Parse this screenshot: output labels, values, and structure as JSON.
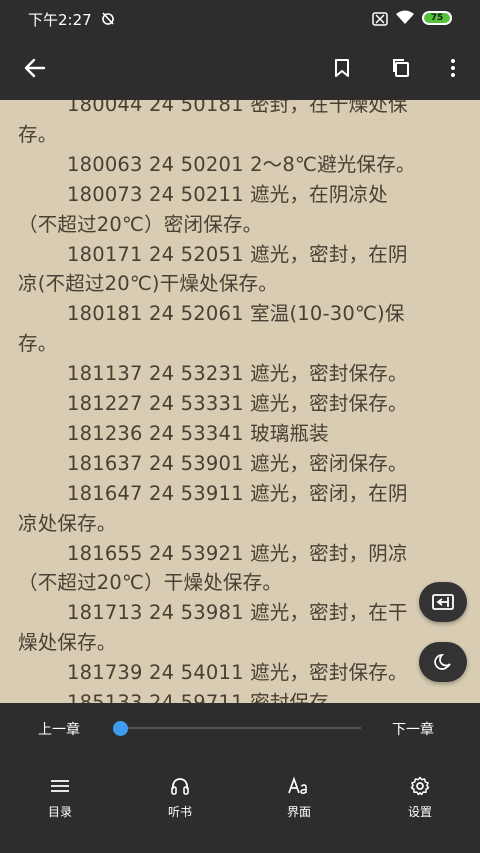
{
  "status_bar": {
    "time": "下午2:27",
    "battery": "75"
  },
  "content": {
    "lines": [
      {
        "text": "180044 24 50181 密封，在干燥处保",
        "indent": true
      },
      {
        "text": "存。",
        "indent": false
      },
      {
        "text": "180063 24 50201 2～8℃避光保存。",
        "indent": true
      },
      {
        "text": "180073 24 50211 遮光，在阴凉处",
        "indent": true
      },
      {
        "text": "（不超过20℃）密闭保存。",
        "indent": false
      },
      {
        "text": "180171 24 52051 遮光，密封，在阴",
        "indent": true
      },
      {
        "text": "凉(不超过20℃)干燥处保存。",
        "indent": false
      },
      {
        "text": "180181 24 52061 室温(10-30℃)保",
        "indent": true
      },
      {
        "text": "存。",
        "indent": false
      },
      {
        "text": "181137 24 53231 遮光，密封保存。",
        "indent": true
      },
      {
        "text": "181227 24 53331 遮光，密封保存。",
        "indent": true
      },
      {
        "text": "181236 24 53341 玻璃瓶装",
        "indent": true
      },
      {
        "text": "181637 24 53901 遮光，密闭保存。",
        "indent": true
      },
      {
        "text": "181647 24 53911 遮光，密闭，在阴",
        "indent": true
      },
      {
        "text": "凉处保存。",
        "indent": false
      },
      {
        "text": "181655 24 53921 遮光，密封，阴凉",
        "indent": true
      },
      {
        "text": "（不超过20℃）干燥处保存。",
        "indent": false
      },
      {
        "text": "181713 24 53981 遮光，密封，在干",
        "indent": true
      },
      {
        "text": "燥处保存。",
        "indent": false
      },
      {
        "text": "181739 24 54011 遮光，密封保存。",
        "indent": true
      },
      {
        "text": "185133 24 59711 密封保存",
        "indent": true
      }
    ]
  },
  "bottom_panel": {
    "prev_chapter": "上一章",
    "next_chapter": "下一章",
    "progress": 0.0,
    "menu": [
      {
        "label": "目录",
        "icon": "list-icon"
      },
      {
        "label": "听书",
        "icon": "headphones-icon"
      },
      {
        "label": "界面",
        "icon": "font-icon"
      },
      {
        "label": "设置",
        "icon": "gear-icon"
      }
    ]
  }
}
